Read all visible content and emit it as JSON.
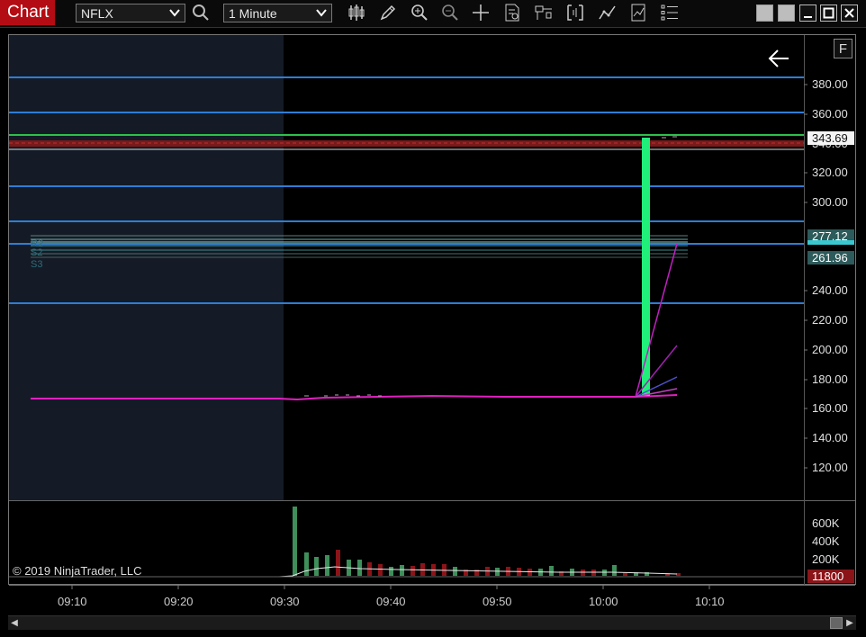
{
  "window": {
    "title": "Chart",
    "instrument": "NFLX",
    "interval": "1 Minute"
  },
  "toolbar": {
    "icons": [
      "search-icon",
      "bar-type-icon",
      "draw-pencil-icon",
      "zoom-in-icon",
      "zoom-out-icon",
      "crosshair-icon",
      "data-box-icon",
      "chart-trader-icon",
      "properties-icon",
      "indicators-icon",
      "strategies-icon",
      "templates-icon"
    ]
  },
  "chart": {
    "back_arrow": "←",
    "f_button": "F",
    "price_axis_labels": [
      "380.00",
      "360.00",
      "340.00",
      "320.00",
      "300.00",
      "240.00",
      "220.00",
      "200.00",
      "180.00",
      "160.00",
      "140.00",
      "120.00"
    ],
    "price_badges": {
      "last": "343.69",
      "level_upper": "277.12",
      "level_lower": "261.96"
    },
    "volume_axis_labels": [
      "600K",
      "400K",
      "200K"
    ],
    "volume_badge": "11800",
    "time_labels": [
      "09:10",
      "09:20",
      "09:30",
      "09:40",
      "09:50",
      "10:00",
      "10:10"
    ],
    "copyright": "© 2019 NinjaTrader, LLC",
    "colors": {
      "premarket_bg": "#141b26",
      "horizontal_line": "#2e7dd6",
      "green_line": "#2ec04b",
      "red_band": "#a52a2a",
      "magenta_ma": "#e020c0",
      "spike_bar": "#20ef7a",
      "vol_up": "#3e8f5a",
      "vol_down": "#8b1419",
      "volume_badge_bg": "#8b1419",
      "level_badge_bg": "#2d5a5a"
    }
  }
}
